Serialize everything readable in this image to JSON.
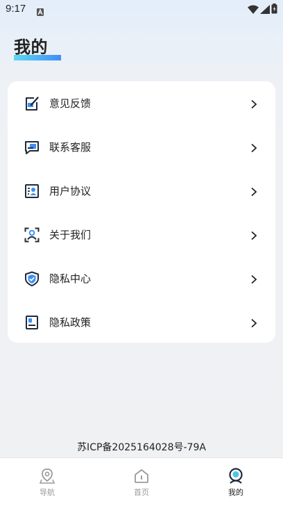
{
  "status_bar": {
    "time": "9:17",
    "icons": [
      "notification-a-icon",
      "wifi-icon",
      "cell-signal-icon",
      "battery-icon"
    ]
  },
  "header": {
    "title": "我的"
  },
  "menu": {
    "items": [
      {
        "label": "意见反馈",
        "icon": "feedback-edit-icon"
      },
      {
        "label": "联系客服",
        "icon": "customer-service-icon"
      },
      {
        "label": "用户协议",
        "icon": "user-agreement-icon"
      },
      {
        "label": "关于我们",
        "icon": "about-us-icon"
      },
      {
        "label": "隐私中心",
        "icon": "privacy-shield-icon"
      },
      {
        "label": "隐私政策",
        "icon": "privacy-policy-icon"
      }
    ]
  },
  "footer": {
    "icp": "苏ICP备2025164028号-79A"
  },
  "bottom_nav": {
    "active": "我的",
    "items": [
      {
        "label": "导航",
        "icon": "location-pin-icon"
      },
      {
        "label": "首页",
        "icon": "home-icon"
      },
      {
        "label": "我的",
        "icon": "profile-icon"
      }
    ]
  },
  "colors": {
    "accent_blue": "#3f8ef6",
    "accent_cyan": "#5dd8f2",
    "text_primary": "#222222",
    "text_inactive": "#9a9a9a"
  }
}
